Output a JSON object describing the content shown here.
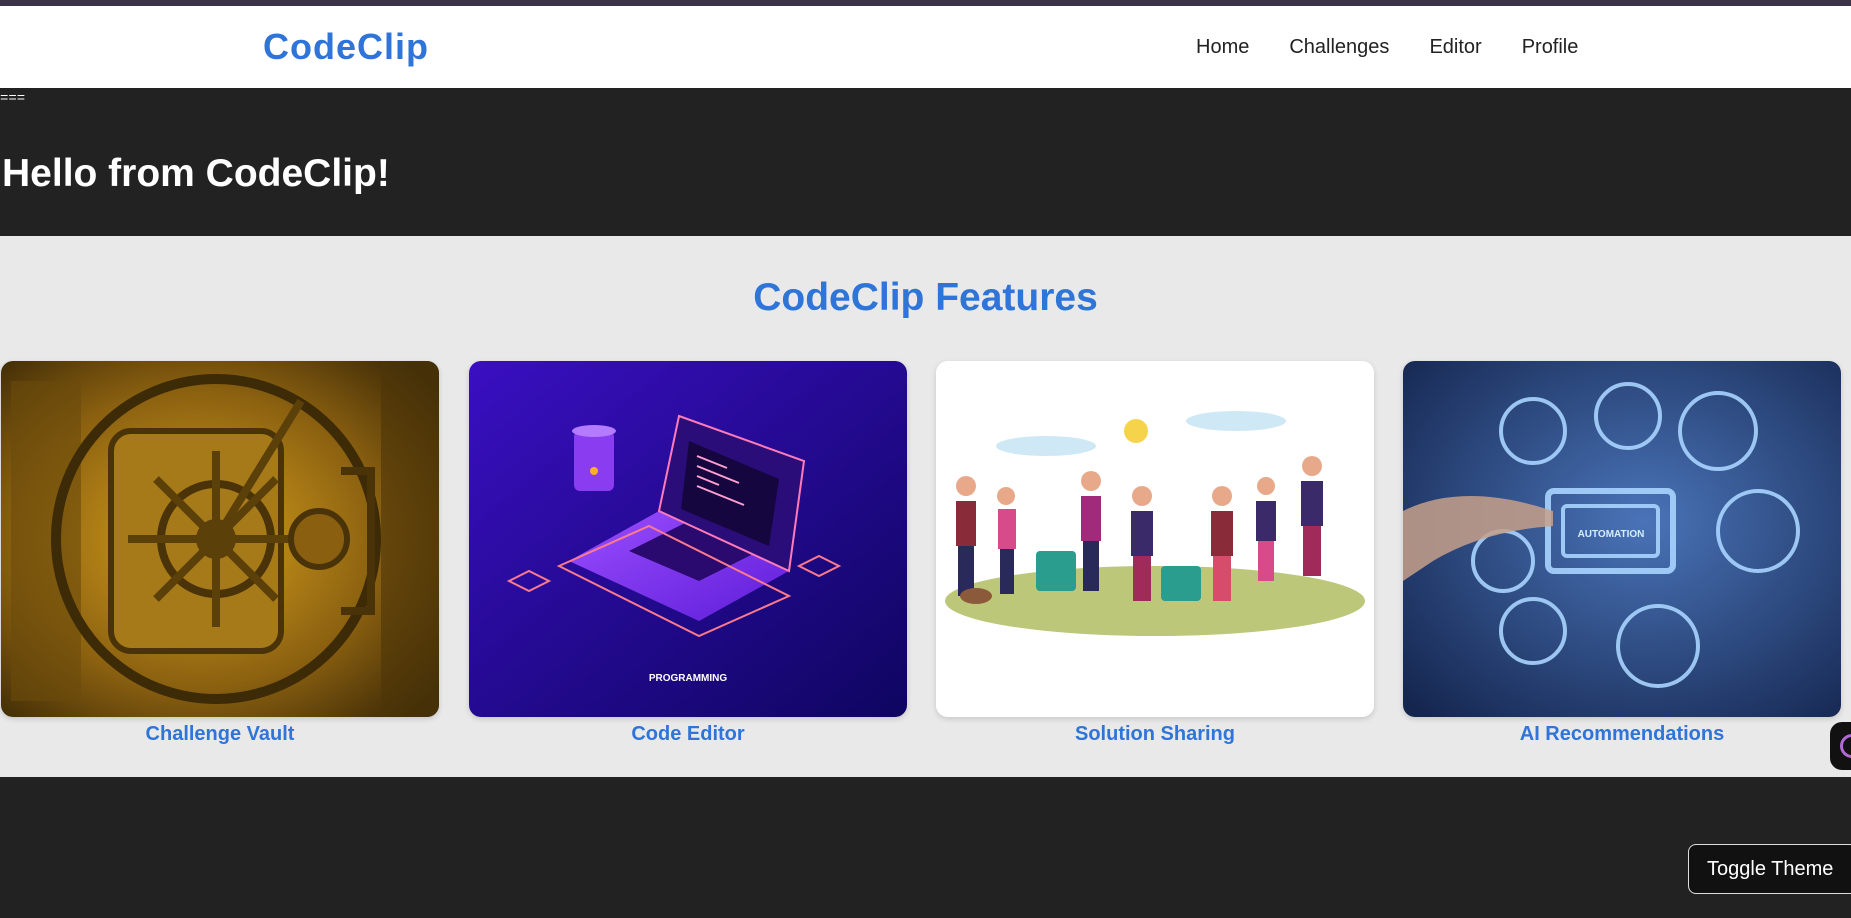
{
  "nav": {
    "brand": "CodeClip",
    "links": [
      "Home",
      "Challenges",
      "Editor",
      "Profile"
    ]
  },
  "hero": {
    "stray_text": "===",
    "title": "Hello from CodeClip!"
  },
  "features": {
    "title": "CodeClip Features",
    "cards": [
      {
        "label": "Challenge Vault",
        "image": "bank-vault-door"
      },
      {
        "label": "Code Editor",
        "image": "isometric-laptop-programming",
        "caption": "PROGRAMMING"
      },
      {
        "label": "Solution Sharing",
        "image": "people-recycling-illustration"
      },
      {
        "label": "AI Recommendations",
        "image": "hand-touching-automation-icons",
        "caption": "AUTOMATION"
      }
    ]
  },
  "footer": {
    "toggle_label": "Toggle Theme"
  },
  "colors": {
    "accent": "#2f74d8",
    "dark_bg": "#222222",
    "light_bg": "#e9e9e9"
  }
}
